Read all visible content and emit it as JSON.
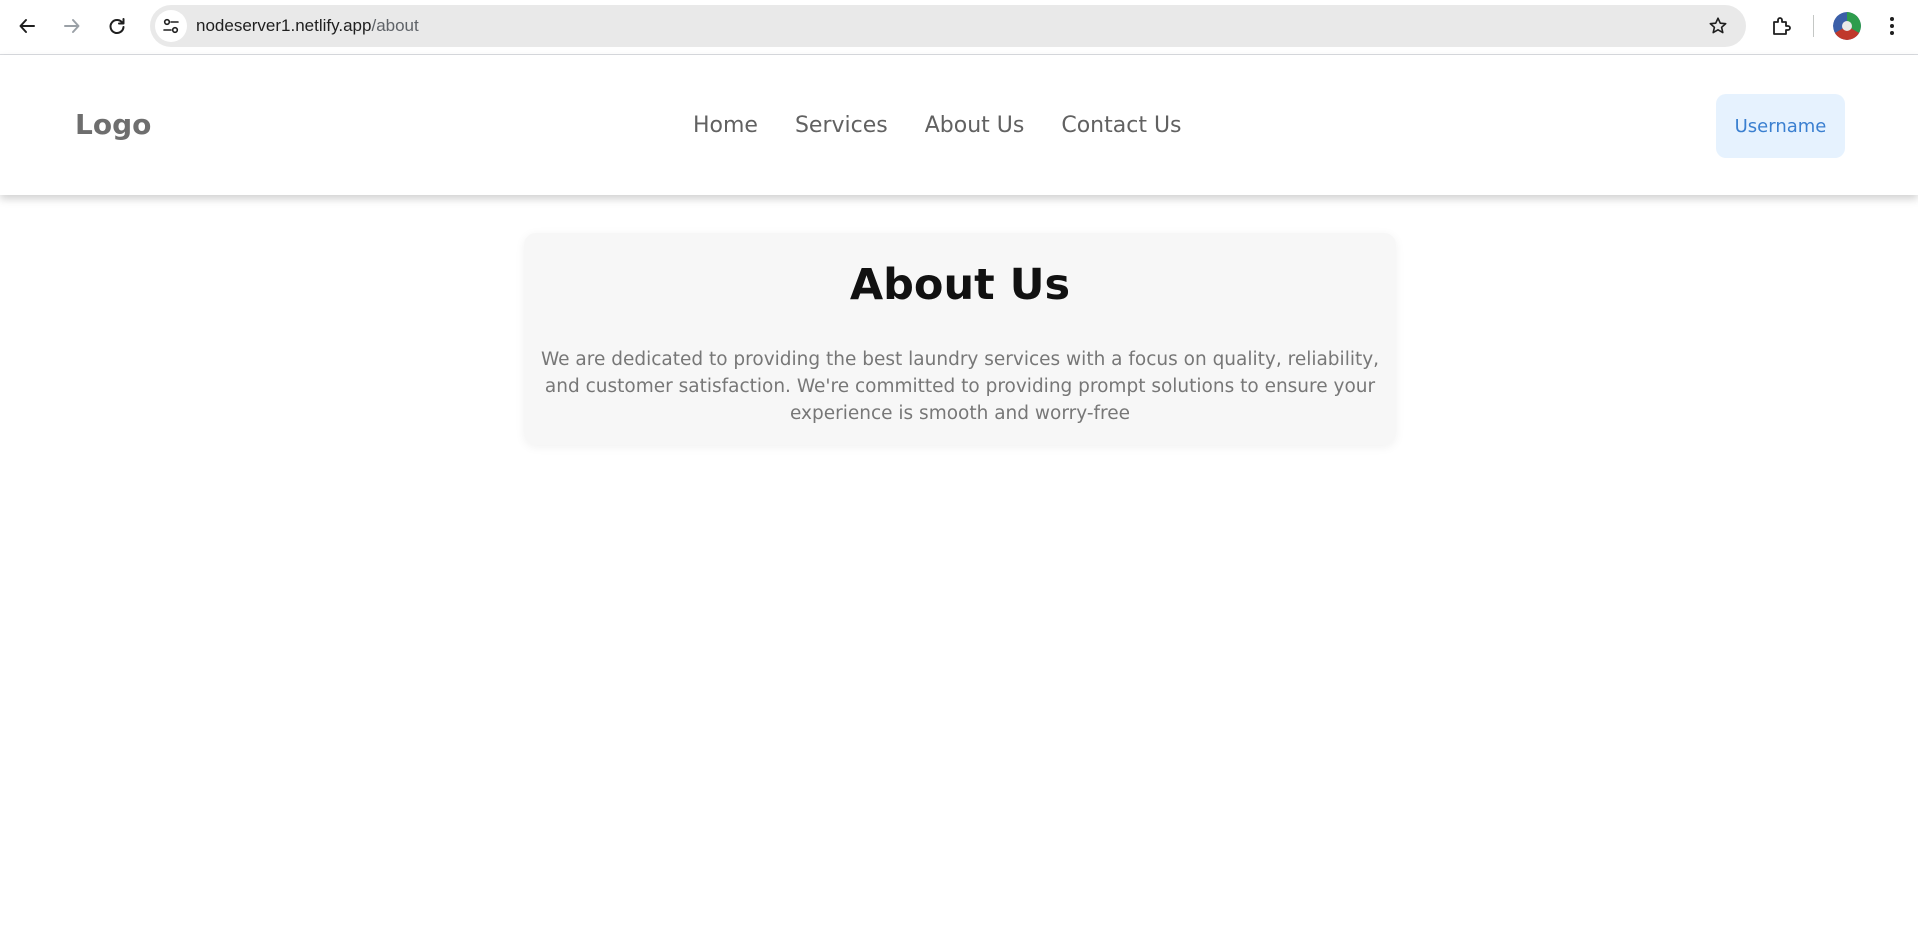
{
  "browser": {
    "url_host": "nodeserver1.netlify.app",
    "url_path": "/about",
    "icons": {
      "back": "arrow-left-icon",
      "forward": "arrow-right-icon",
      "reload": "reload-icon",
      "site_info": "tune-icon",
      "bookmark": "star-icon",
      "extensions": "puzzle-icon",
      "menu": "kebab-menu-icon"
    }
  },
  "header": {
    "logo": "Logo",
    "nav": [
      {
        "label": "Home"
      },
      {
        "label": "Services"
      },
      {
        "label": "About Us"
      },
      {
        "label": "Contact Us"
      }
    ],
    "user_button": "Username"
  },
  "main": {
    "title": "About Us",
    "description": "We are dedicated to providing the best laundry services with a focus on quality, reliability, and customer satisfaction. We're committed to providing prompt solutions to ensure your experience is smooth and worry-free"
  },
  "colors": {
    "user_button_bg": "#e6f2fe",
    "user_button_text": "#3a7fd0",
    "card_bg": "#f7f7f7"
  }
}
